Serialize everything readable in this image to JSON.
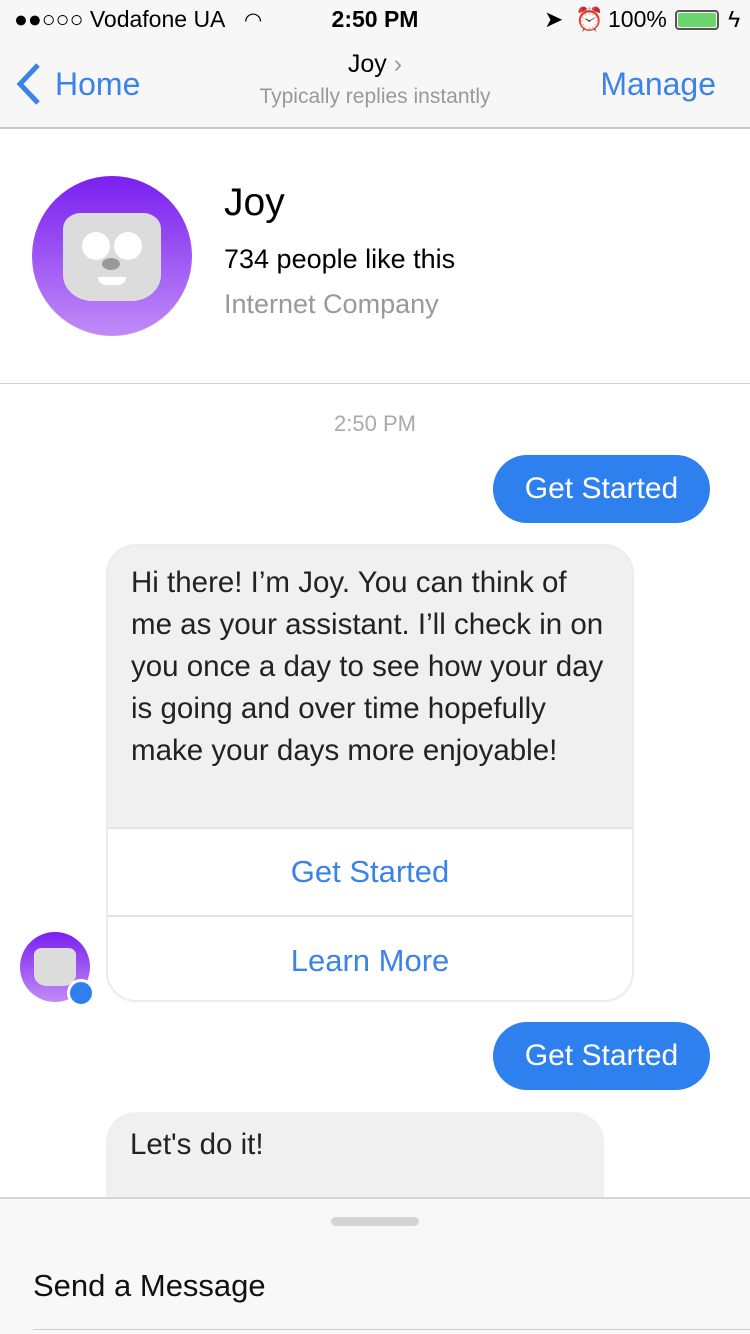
{
  "status_bar": {
    "carrier": "●●○○○ Vodafone UA",
    "time": "2:50 PM",
    "battery": "100%",
    "battery_color": "#6cd66c"
  },
  "nav": {
    "back_label": "Home",
    "title": "Joy",
    "subtitle": "Typically replies instantly",
    "manage_label": "Manage"
  },
  "profile": {
    "name": "Joy",
    "likes": "734 people like this",
    "category": "Internet Company"
  },
  "chat": {
    "timestamp": "2:50 PM",
    "messages": [
      {
        "from": "user",
        "text": "Get Started"
      },
      {
        "from": "bot",
        "text": "Hi there! I’m Joy. You can think of me as your assistant. I’ll check in on you once a day to see how your day is going and over time hopefully make your days more enjoyable!",
        "buttons": [
          "Get Started",
          "Learn More"
        ]
      },
      {
        "from": "user",
        "text": "Get Started"
      },
      {
        "from": "bot",
        "text": "Let's do it!"
      }
    ]
  },
  "composer": {
    "placeholder": "Send a Message"
  },
  "colors": {
    "accent": "#3b83e8",
    "bubble": "#2f80ef",
    "avatar_top": "#7a1ff0",
    "avatar_bottom": "#c08cf6"
  }
}
